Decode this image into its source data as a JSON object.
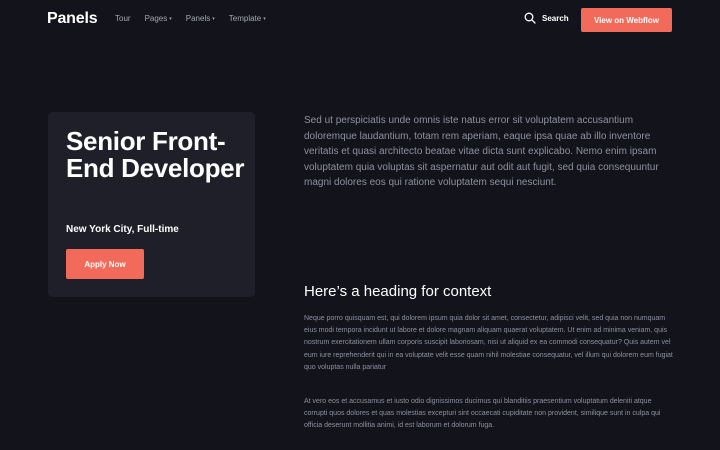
{
  "header": {
    "logo": "Panels",
    "nav": [
      {
        "label": "Tour",
        "has_dropdown": false
      },
      {
        "label": "Pages",
        "has_dropdown": true
      },
      {
        "label": "Panels",
        "has_dropdown": true
      },
      {
        "label": "Template",
        "has_dropdown": true
      }
    ],
    "caret": "▾",
    "search_label": "Search",
    "search_icon": "search-icon",
    "cta_label": "View on Webflow"
  },
  "card": {
    "title": "Senior Front-End Developer",
    "meta": "New York City, Full-time",
    "apply_label": "Apply Now"
  },
  "content": {
    "intro": "Sed ut perspiciatis unde omnis iste natus error sit voluptatem accusantium doloremque laudantium, totam rem aperiam, eaque ipsa quae ab illo inventore veritatis et quasi architecto beatae vitae dicta sunt explicabo. Nemo enim ipsam voluptatem quia voluptas sit aspernatur aut odit aut fugit, sed quia consequuntur magni dolores eos qui ratione voluptatem sequi nesciunt.",
    "heading": "Here’s a heading for context",
    "paragraph_1": "Neque porro quisquam est, qui dolorem ipsum quia dolor sit amet, consectetur, adipisci velit, sed quia non numquam eius modi tempora incidunt ut labore et dolore magnam aliquam quaerat voluptatem. Ut enim ad minima veniam, quis nostrum exercitationem ullam corporis suscipit laboriosam, nisi ut aliquid ex ea commodi consequatur? Quis autem vel eum iure reprehenderit qui in ea voluptate velit esse quam nihil molestiae consequatur, vel illum qui dolorem eum fugiat quo voluptas nulla pariatur",
    "paragraph_2": "At vero eos et accusamus et iusto odio dignissimos ducimus qui blanditiis praesentium voluptatum deleniti atque corrupti quos dolores et quas molestias excepturi sint occaecati cupiditate non provident, similique sunt in culpa qui officia deserunt mollitia animi, id est laborum et dolorum fuga."
  },
  "colors": {
    "background": "#13141b",
    "card": "#1e1f28",
    "accent": "#f26a5a",
    "muted_text": "#8d909f"
  }
}
